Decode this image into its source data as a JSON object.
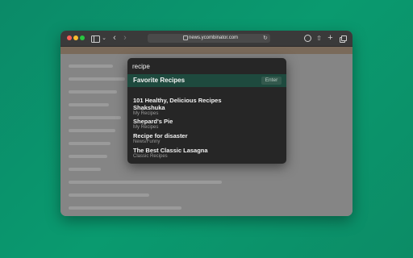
{
  "browser": {
    "url": "news.ycombinator.com"
  },
  "palette": {
    "query": "recipe",
    "highlighted": {
      "label": "Favorite Recipes",
      "badge": "Enter"
    },
    "items": [
      {
        "title": "101 Healthy, Delicious Recipes",
        "subtitle": ""
      },
      {
        "title": "Shakshuka",
        "subtitle": "My Recipes"
      },
      {
        "title": "Shepard's Pie",
        "subtitle": "My Recipes"
      },
      {
        "title": "Recipe for disaster",
        "subtitle": "News/Funny"
      },
      {
        "title": "The Best Classic Lasagna",
        "subtitle": "Classic Recipes"
      }
    ]
  },
  "colors": {
    "background": "#0a9a6f",
    "highlight": "#1e4a3e",
    "palette_bg": "#262626"
  },
  "icons": [
    "sidebar-icon",
    "chevron-down-icon",
    "back-icon",
    "forward-icon",
    "lock-icon",
    "reload-icon",
    "download-icon",
    "share-icon",
    "new-tab-icon",
    "tab-overview-icon"
  ]
}
